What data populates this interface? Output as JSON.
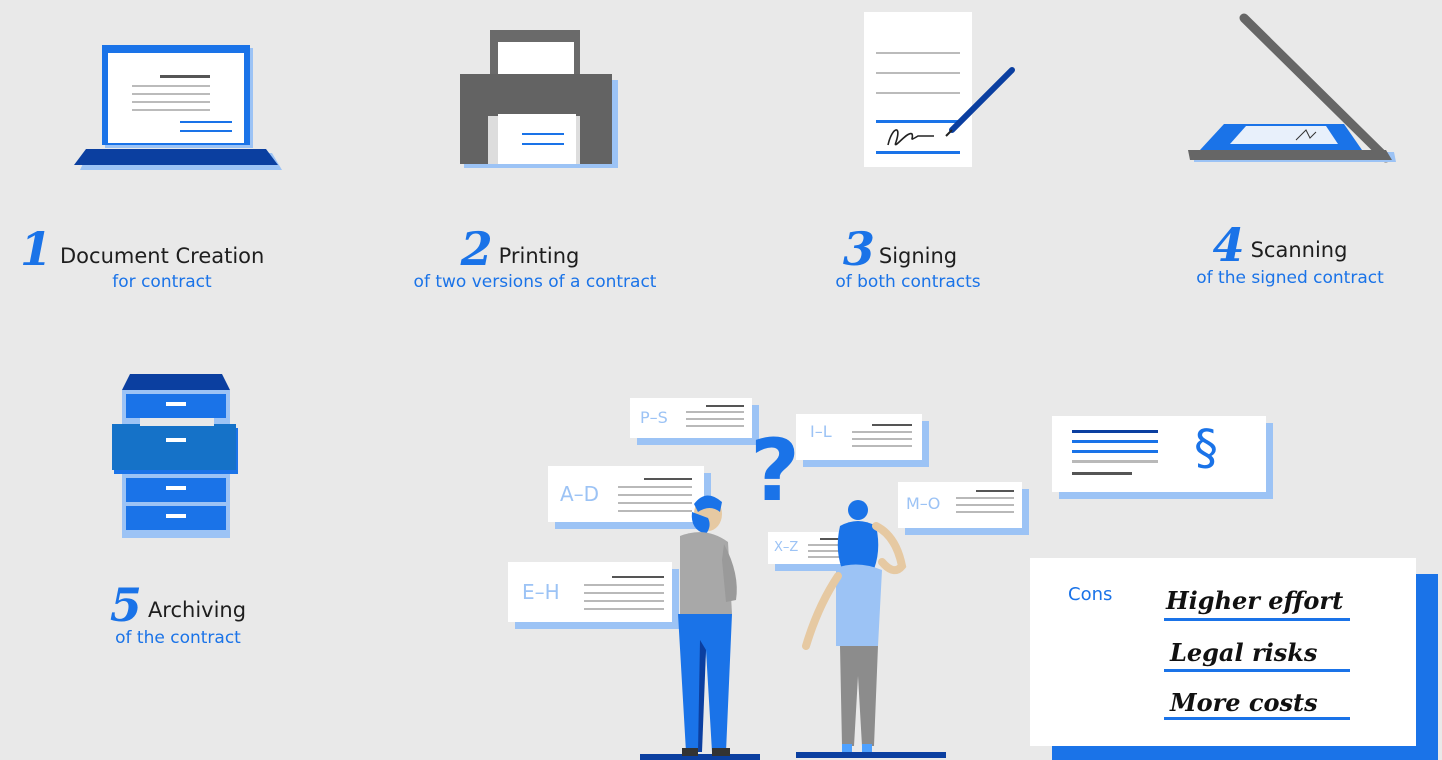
{
  "steps": [
    {
      "num": "1",
      "title": "Document Creation",
      "sub": "for contract"
    },
    {
      "num": "2",
      "title": "Printing",
      "sub": "of two versions of a contract"
    },
    {
      "num": "3",
      "title": "Signing",
      "sub": "of both contracts"
    },
    {
      "num": "4",
      "title": "Scanning",
      "sub": "of the signed contract"
    },
    {
      "num": "5",
      "title": "Archiving",
      "sub": "of the contract"
    }
  ],
  "index_cards": [
    "P–S",
    "I–L",
    "A–D",
    "M–O",
    "X–Z",
    "E–H"
  ],
  "question_mark": "?",
  "paragraph_symbol": "§",
  "cons": {
    "label": "Cons",
    "items": [
      "Higher effort",
      "Legal risks",
      "More costs"
    ]
  },
  "colors": {
    "accent": "#1a73e8",
    "light_accent": "#9cc3f5",
    "dark_blue": "#0b3fa0",
    "background": "#e9e9e9"
  }
}
